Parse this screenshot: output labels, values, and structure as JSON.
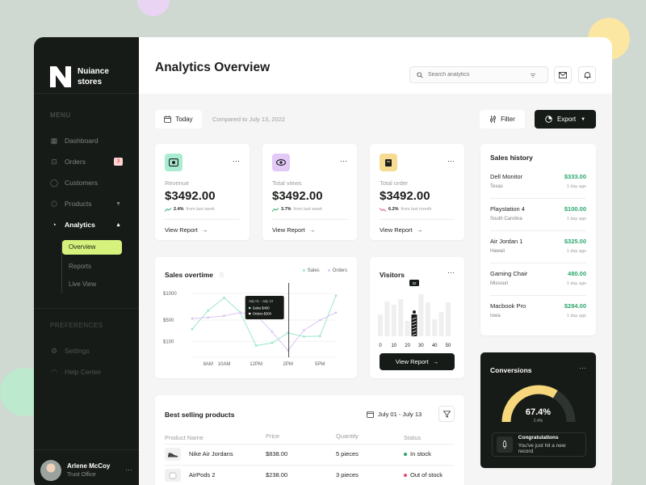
{
  "brand": {
    "name": "Nuiance stores"
  },
  "sidebar": {
    "menu_title": "MENU",
    "items": [
      {
        "label": "Dashboard"
      },
      {
        "label": "Orders",
        "badge": "3"
      },
      {
        "label": "Customers"
      },
      {
        "label": "Products"
      },
      {
        "label": "Analytics"
      }
    ],
    "sub_items": [
      {
        "label": "Overview"
      },
      {
        "label": "Reports"
      },
      {
        "label": "Live View"
      }
    ],
    "preferences_title": "PREFERENCES",
    "pref_items": [
      {
        "label": "Settings"
      },
      {
        "label": "Help Center"
      }
    ]
  },
  "user": {
    "name": "Arlene McCoy",
    "role": "Trust Office"
  },
  "header": {
    "title": "Analytics Overview",
    "search_placeholder": "Search analytics"
  },
  "toolbar": {
    "today_label": "Today",
    "compared_text": "Compared to July 13, 2022",
    "filter_label": "Filter",
    "export_label": "Export"
  },
  "stats": [
    {
      "label": "Revenue",
      "value": "$3492.00",
      "trend": "2.4%",
      "trend_text": "from last week",
      "link": "View Report",
      "trend_dir": "up"
    },
    {
      "label": "Total views",
      "value": "$3492.00",
      "trend": "3.7%",
      "trend_text": "from last week",
      "link": "View Report",
      "trend_dir": "up"
    },
    {
      "label": "Total order",
      "value": "$3492.00",
      "trend": "6.2%",
      "trend_text": "from last month",
      "link": "View Report",
      "trend_dir": "down"
    }
  ],
  "sales_chart": {
    "title": "Sales overtime",
    "legend": [
      "Sales",
      "Orders"
    ],
    "tooltip": {
      "date": "July 01 - July 13",
      "sales_label": "Sales",
      "sales_value": "$400",
      "orders_label": "Orders",
      "orders_value": "$300"
    }
  },
  "visitors": {
    "title": "Visitors",
    "button": "View Report",
    "highlight_label": "32"
  },
  "sales_history": {
    "title": "Sales history",
    "rows": [
      {
        "name": "Dell Monitor",
        "location": "Texas",
        "amount": "$333.00",
        "time": "1 day ago"
      },
      {
        "name": "Playstation 4",
        "location": "South Carolina",
        "amount": "$100.00",
        "time": "1 day ago"
      },
      {
        "name": "Air Jordan 1",
        "location": "Hawaii",
        "amount": "$325.00",
        "time": "1 day ago"
      },
      {
        "name": "Gaming Chair",
        "location": "Missouri",
        "amount": "480.00",
        "time": "1 day ago"
      },
      {
        "name": "Macbook Pro",
        "location": "Iowa",
        "amount": "$284.00",
        "time": "1 day ago"
      }
    ]
  },
  "conversions": {
    "title": "Conversions",
    "value": "67.4%",
    "sub": "2.4%",
    "gauge_fraction": 0.674,
    "note_title": "Congratulations",
    "note_text": "You've just hit a new record"
  },
  "products": {
    "title": "Best selling products",
    "date_range": "July 01 - July 13",
    "columns": [
      "Product Name",
      "Price",
      "Quantity",
      "Status"
    ],
    "rows": [
      {
        "name": "Nike Air Jordans",
        "price": "$838.00",
        "quantity": "5 pieces",
        "status": "In stock",
        "status_color": "#2aa76a"
      },
      {
        "name": "AirPods 2",
        "price": "$238.00",
        "quantity": "3 pieces",
        "status": "Out of stock",
        "status_color": "#e0526b"
      }
    ]
  },
  "colors": {
    "accent": "#d6f27c",
    "dark": "#171b18",
    "green": "#2aa76a",
    "sales_line": "#9de6cf",
    "orders_line": "#dcc6f2"
  },
  "chart_data": [
    {
      "type": "line",
      "title": "Sales overtime",
      "x": [
        "",
        "8AM",
        "10AM",
        "",
        "12PM",
        "",
        "2PM",
        "",
        "5PM",
        ""
      ],
      "series": [
        {
          "name": "Sales",
          "values": [
            330,
            680,
            920,
            650,
            20,
            70,
            260,
            190,
            200,
            960
          ]
        },
        {
          "name": "Orders",
          "values": [
            530,
            550,
            580,
            640,
            600,
            280,
            -70,
            310,
            500,
            640
          ]
        }
      ],
      "ylim": [
        -200,
        1200
      ],
      "yticks": [
        "$1000",
        "$500",
        "$100"
      ],
      "xlabel": "",
      "ylabel": "",
      "legend": "top-right",
      "grid": true
    },
    {
      "type": "bar",
      "title": "Visitors",
      "categories": [
        "0",
        "10",
        "20",
        "30",
        "40",
        "50"
      ],
      "values": [
        27,
        43,
        39,
        46,
        19,
        27,
        52,
        42,
        21,
        30,
        42
      ],
      "ylim": [
        0,
        60
      ],
      "highlight_label": "32"
    }
  ]
}
